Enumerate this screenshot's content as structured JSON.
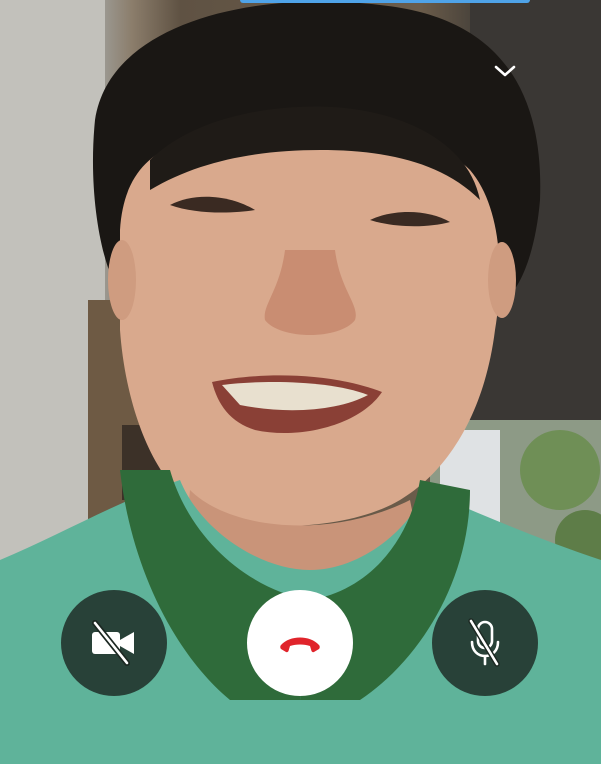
{
  "call": {
    "state": "in-call",
    "accent_color": "#4fa3e8",
    "end_call_color": "#e0242b"
  },
  "top_bar": {
    "minimize_icon": "chevron-down-icon"
  },
  "controls": {
    "video_toggle": {
      "icon": "video-off-icon",
      "state": "off"
    },
    "end_call": {
      "icon": "phone-hangup-icon"
    },
    "mic_toggle": {
      "icon": "mic-off-icon",
      "state": "muted"
    }
  }
}
